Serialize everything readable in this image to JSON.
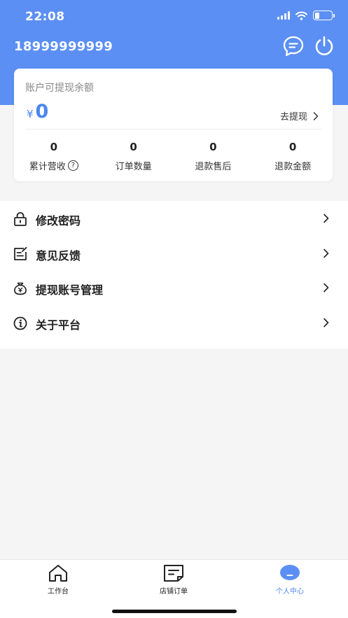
{
  "status_bar": {
    "time": "22:08",
    "signal_icon": "cellular-signal-icon",
    "wifi_icon": "wifi-icon",
    "battery_icon": "battery-icon",
    "battery_level": 0.3
  },
  "header": {
    "phone": "18999999999",
    "message_icon": "message-icon",
    "power_icon": "power-icon",
    "background_color": "#5b8ff3"
  },
  "balance": {
    "title": "账户可提现余额",
    "currency": "¥",
    "amount": "0",
    "withdraw_label": "去提现",
    "accent_color": "#4a86ef"
  },
  "stats": [
    {
      "value": "0",
      "label": "累计营收"
    },
    {
      "value": "0",
      "label": "订单数量"
    },
    {
      "value": "0",
      "label": "退款售后"
    },
    {
      "value": "0",
      "label": "退款金额"
    }
  ],
  "help_glyph": "?",
  "menu": [
    {
      "label": "修改密码",
      "icon": "lock-icon"
    },
    {
      "label": "意见反馈",
      "icon": "feedback-icon"
    },
    {
      "label": "提现账号管理",
      "icon": "money-bag-icon"
    },
    {
      "label": "关于平台",
      "icon": "info-icon"
    }
  ],
  "tabbar": [
    {
      "label": "工作台",
      "icon": "home-icon",
      "active": false
    },
    {
      "label": "店铺订单",
      "icon": "order-list-icon",
      "active": false
    },
    {
      "label": "个人中心",
      "icon": "profile-icon",
      "active": true
    }
  ]
}
